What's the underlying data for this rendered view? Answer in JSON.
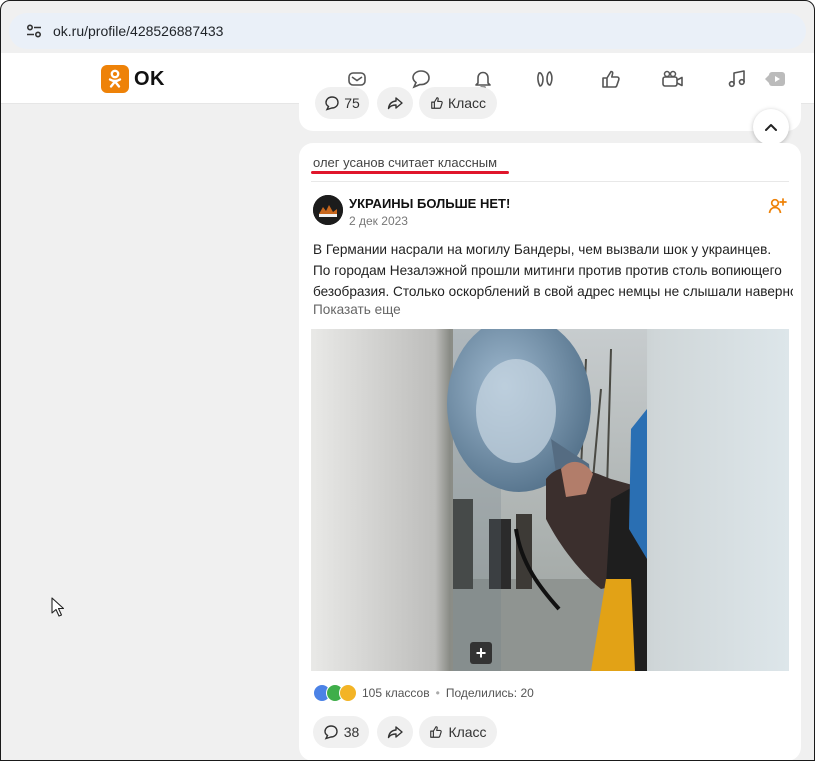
{
  "browser": {
    "url": "ok.ru/profile/428526887433"
  },
  "header": {
    "logo_text": "OK",
    "icons": [
      "mail-icon",
      "chat-icon",
      "bell-icon",
      "guests-icon",
      "likes-icon",
      "video-icon",
      "music-icon",
      "games-icon"
    ]
  },
  "prev_post": {
    "comment_count": "75",
    "like_label": "Класс"
  },
  "post": {
    "liked_by": "олег усанов считает классным",
    "group_name": "УКРАИНЫ БОЛЬШЕ НЕТ!",
    "date": "2 дек 2023",
    "text_lines": [
      "В Германии насрали на могилу Бандеры, чем вызвали шок у украинцев.",
      "По городам Незалэжной прошли митинги против против столь вопиющего",
      "безобразия. Столько оскорблений в свой адрес немцы не слышали наверное"
    ],
    "show_more": "Показать еще",
    "reactions_text": "105 классов",
    "shares_text": "Поделились: 20",
    "comment_count": "38",
    "like_label": "Класс"
  },
  "colors": {
    "accent": "#ee8208",
    "underline": "#e0162b"
  }
}
